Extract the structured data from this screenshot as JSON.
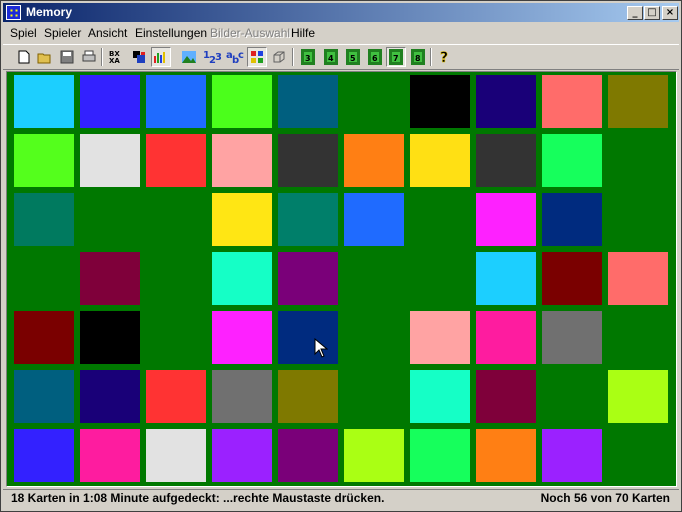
{
  "window": {
    "title": "Memory"
  },
  "menu": [
    {
      "label": "Spiel",
      "disabled": false
    },
    {
      "label": "Spieler",
      "disabled": false
    },
    {
      "label": "Ansicht",
      "disabled": false
    },
    {
      "label": "Einstellungen",
      "disabled": false
    },
    {
      "label": "Bilder-Auswahl",
      "disabled": true
    },
    {
      "label": "Hilfe",
      "disabled": false
    }
  ],
  "toolbar": {
    "buttons": [
      {
        "icon": "new-document-icon"
      },
      {
        "icon": "open-folder-icon"
      },
      {
        "icon": "save-disk-icon"
      },
      {
        "icon": "print-icon"
      },
      {
        "icon": "sort-letters-icon",
        "text": "BX"
      },
      {
        "icon": "colors-icon"
      },
      {
        "icon": "statistics-icon",
        "pressed": true
      },
      {
        "icon": "landscape-icon"
      },
      {
        "icon": "numbers-icon",
        "text": "123"
      },
      {
        "icon": "letters-icon",
        "text": "abc"
      },
      {
        "icon": "colored-squares-icon",
        "pressed": true
      },
      {
        "icon": "3d-cube-icon"
      },
      {
        "icon": "card-set-1-icon"
      },
      {
        "icon": "card-set-2-icon"
      },
      {
        "icon": "card-set-3-icon"
      },
      {
        "icon": "card-set-4-icon"
      },
      {
        "icon": "card-set-5-icon",
        "pressed": true
      },
      {
        "icon": "card-set-6-icon"
      },
      {
        "icon": "help-icon",
        "text": "?"
      }
    ]
  },
  "board": {
    "background": "#007800",
    "rows": [
      [
        "#1ccfff",
        "#3321ff",
        "#1f6bff",
        "#4bff1b",
        "#005f7f",
        null,
        "#000000",
        "#190078",
        "#ff6c6a",
        "#7f7900"
      ],
      [
        "#54ff1c",
        "#e2e2e2",
        "#ff3333",
        "#ffa3a3",
        "#333333",
        "#ff7f14",
        "#ffe014",
        "#333333",
        "#16ff5c",
        null
      ],
      [
        "#007a5f",
        null,
        null,
        "#ffe614",
        "#007f6a",
        "#1f6bff",
        null,
        "#fe21ff",
        "#002b7f",
        null
      ],
      [
        null,
        "#7f003a",
        null,
        "#15ffc6",
        "#7a0079",
        null,
        null,
        "#1ccfff",
        "#7a0000",
        "#ff6c6a"
      ],
      [
        "#7a0000",
        "#000000",
        null,
        "#fe21ff",
        "#002b7f",
        null,
        "#ffa3a3",
        "#fe1c9f",
        "#707070",
        null
      ],
      [
        "#005f7f",
        "#190078",
        "#ff3333",
        "#707070",
        "#7f7900",
        null,
        "#15ffc6",
        "#7f003a",
        null,
        "#aaff14"
      ],
      [
        "#3321ff",
        "#fe1c9f",
        "#e2e2e2",
        "#9b21ff",
        "#7a0079",
        "#aaff14",
        "#16ff5c",
        "#ff7f14",
        "#9b21ff",
        null
      ]
    ]
  },
  "status": {
    "left": "18 Karten in 1:08 Minute aufgedeckt: ...rechte Maustaste drücken.",
    "right": "Noch 56 von 70 Karten"
  }
}
